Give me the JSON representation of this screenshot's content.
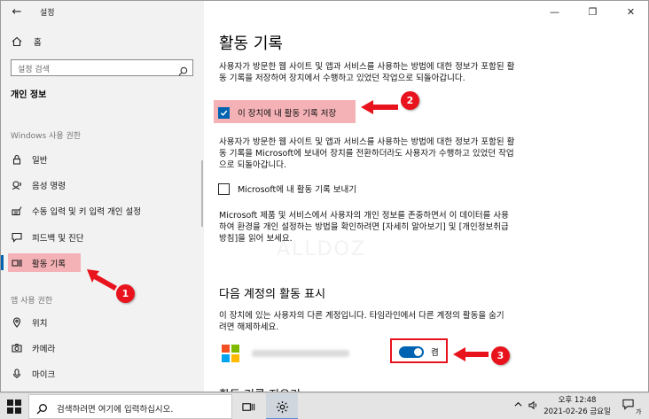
{
  "window": {
    "app_title": "설정",
    "back_glyph": "←",
    "controls": {
      "minimize": "—",
      "maximize": "❐",
      "close": "✕"
    }
  },
  "sidebar": {
    "home_label": "홈",
    "search_placeholder": "설정 검색",
    "section_title": "개인 정보",
    "group_windows": "Windows 사용 권한",
    "items_windows": [
      {
        "label": "일반",
        "icon": "lock-icon"
      },
      {
        "label": "음성 명령",
        "icon": "speech-icon"
      },
      {
        "label": "수동 입력 및 키 입력 개인 설정",
        "icon": "pen-keyboard-icon"
      },
      {
        "label": "피드백 및 진단",
        "icon": "feedback-icon"
      },
      {
        "label": "활동 기록",
        "icon": "timeline-icon",
        "selected": true
      }
    ],
    "group_app": "앱 사용 권한",
    "items_app": [
      {
        "label": "위치",
        "icon": "location-icon"
      },
      {
        "label": "카메라",
        "icon": "camera-icon"
      },
      {
        "label": "마이크",
        "icon": "microphone-icon"
      }
    ]
  },
  "content": {
    "title": "활동 기록",
    "para1": "사용자가 방문한 웹 사이트 및 앱과 서비스를 사용하는 방법에 대한 정보가 포함된 활동 기록을 저장하여 장치에서 수행하고 있었던 작업으로 되돌아갑니다.",
    "checkbox_store": {
      "label": "이 장치에 내 활동 기록 저장",
      "checked": true
    },
    "para2": "사용자가 방문한 웹 사이트 및 앱과 서비스를 사용하는 방법에 대한 정보가 포함된 활동 기록을 Microsoft에 보내어 장치를 전환하더라도 사용자가 수행하고 있었던 작업으로 되돌아갑니다.",
    "checkbox_send": {
      "label": "Microsoft에 내 활동 기록 보내기",
      "checked": false
    },
    "para3": "Microsoft 제품 및 서비스에서 사용자의 개인 정보를 존중하면서 이 데이터를 사용하여 환경을 개인 설정하는 방법을 확인하려면 [자세히 알아보기] 및 [개인정보취급방침]을 읽어 보세요.",
    "section2_title": "다음 계정의 활동 표시",
    "section2_desc": "이 장치에 있는 사용자의 다른 계정입니다. 타임라인에서 다른 계정의 활동을 숨기려면 해제하세요.",
    "account_toggle": {
      "state_label": "켬",
      "on": true
    },
    "section3_title": "활동 기록 지우기",
    "watermark": "ALLDOZ"
  },
  "annotations": [
    "1",
    "2",
    "3"
  ],
  "taskbar": {
    "search_placeholder": "검색하려면 여기에 입력하십시오.",
    "time": "오후 12:48",
    "date": "2021-02-26 금요일",
    "ime": "가"
  },
  "colors": {
    "accent": "#0063b1",
    "annotation_red": "#e8131c",
    "highlight_pink": "#f4b2b6",
    "sidebar_bg": "#f2f2f2"
  }
}
